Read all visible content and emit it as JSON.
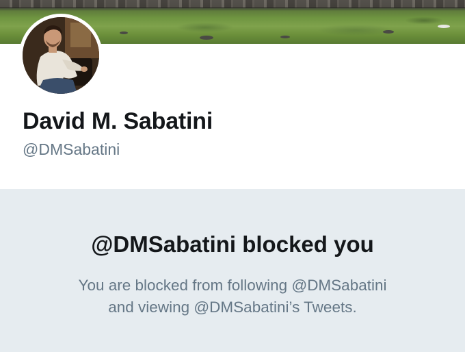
{
  "profile": {
    "name": "David M. Sabatini",
    "handle": "@DMSabatini"
  },
  "blocked": {
    "title": "@DMSabatini blocked you",
    "message_line_1": "You are blocked from following @DMSabatini",
    "message_line_2": "and viewing @DMSabatini’s Tweets."
  },
  "colors": {
    "name_text": "#14171a",
    "secondary_text": "#657786",
    "panel_background": "#e6ecf0",
    "page_background": "#ffffff"
  }
}
